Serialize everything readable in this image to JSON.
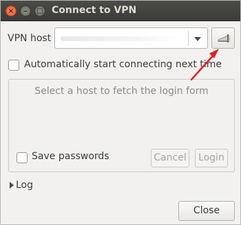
{
  "window": {
    "title": "Connect to VPN"
  },
  "host": {
    "label": "VPN host",
    "value": ""
  },
  "auto_connect": {
    "label": "Automatically start connecting next time",
    "checked": false
  },
  "login_form": {
    "hint": "Select a host to fetch the login form",
    "save_passwords": {
      "label": "Save passwords",
      "checked": false
    },
    "cancel_label": "Cancel",
    "login_label": "Login"
  },
  "log": {
    "label": "Log"
  },
  "close_label": "Close",
  "icons": {
    "window_close": "close-icon",
    "window_minimize": "minimize-icon",
    "window_maximize": "maximize-icon",
    "connect": "connect-icon",
    "dropdown": "chevron-down-icon",
    "expander": "triangle-right-icon"
  },
  "colors": {
    "annotation_arrow": "#e02020",
    "titlebar": "#3c3b37"
  }
}
